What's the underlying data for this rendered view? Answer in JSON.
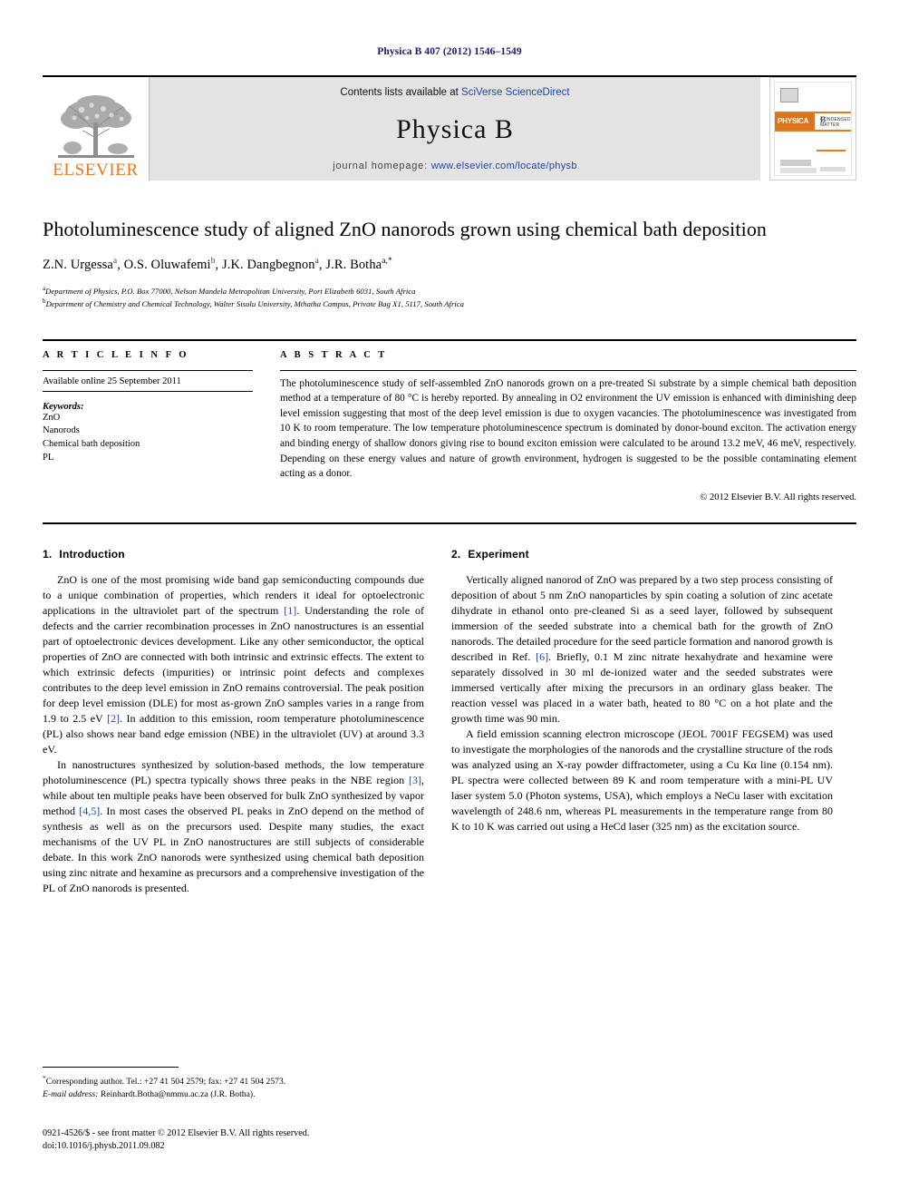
{
  "running_head": "Physica B 407 (2012) 1546–1549",
  "masthead": {
    "publisher_name": "ELSEVIER",
    "contents_prefix": "Contents lists available at ",
    "contents_link": "SciVerse ScienceDirect",
    "journal_name": "Physica B",
    "homepage_prefix": "journal homepage: ",
    "homepage_url": "www.elsevier.com/locate/physb",
    "cover": {
      "title": "PHYSICA",
      "volume_letter": "B",
      "subtitle": "CONDENSED MATTER"
    }
  },
  "article": {
    "title": "Photoluminescence study of aligned ZnO nanorods grown using chemical bath deposition",
    "authors_html": "Z.N. Urgessa a, O.S. Oluwafemi b, J.K. Dangbegnon a, J.R. Botha a,*",
    "authors": [
      {
        "name": "Z.N. Urgessa",
        "marks": "a"
      },
      {
        "name": "O.S. Oluwafemi",
        "marks": "b"
      },
      {
        "name": "J.K. Dangbegnon",
        "marks": "a"
      },
      {
        "name": "J.R. Botha",
        "marks": "a,*"
      }
    ],
    "affiliations": [
      {
        "mark": "a",
        "text": "Department of Physics, P.O. Box 77000, Nelson Mandela Metropolitan University, Port Elizabeth 6031, South Africa"
      },
      {
        "mark": "b",
        "text": "Department of Chemistry and Chemical Technology, Walter Sisulu University, Mthatha Campus, Private Bag X1, 5117, South Africa"
      }
    ]
  },
  "article_info": {
    "heading": "A R T I C L E  I N F O",
    "available_online": "Available online 25 September 2011",
    "keywords_label": "Keywords:",
    "keywords": [
      "ZnO",
      "Nanorods",
      "Chemical bath deposition",
      "PL"
    ]
  },
  "abstract": {
    "heading": "A B S T R A C T",
    "text": "The photoluminescence study of self-assembled ZnO nanorods grown on a pre-treated Si substrate by a simple chemical bath deposition method at a temperature of 80 °C is hereby reported. By annealing in O2 environment the UV emission is enhanced with diminishing deep level emission suggesting that most of the deep level emission is due to oxygen vacancies. The photoluminescence was investigated from 10 K to room temperature. The low temperature photoluminescence spectrum is dominated by donor-bound exciton. The activation energy and binding energy of shallow donors giving rise to bound exciton emission were calculated to be around 13.2 meV, 46 meV, respectively. Depending on these energy values and nature of growth environment, hydrogen is suggested to be the possible contaminating element acting as a donor.",
    "copyright": "© 2012 Elsevier B.V. All rights reserved."
  },
  "sections": {
    "introduction": {
      "heading_number": "1.",
      "heading_title": "Introduction",
      "paragraph1_a": "ZnO is one of the most promising wide band gap semiconducting compounds due to a unique combination of properties, which renders it ideal for optoelectronic applications in the ultraviolet part of the spectrum ",
      "paragraph1_ref1": "[1]",
      "paragraph1_b": ". Understanding the role of defects and the carrier recombination processes in ZnO nanostructures is an essential part of optoelectronic devices development. Like any other semiconductor, the optical properties of ZnO are connected with both intrinsic and extrinsic effects. The extent to which extrinsic defects (impurities) or intrinsic point defects and complexes contributes to the deep level emission in ZnO remains controversial. The peak position for deep level emission (DLE) for most as-grown ZnO samples varies in a range from 1.9 to 2.5 eV ",
      "paragraph1_ref2": "[2]",
      "paragraph1_c": ". In addition to this emission, room temperature photoluminescence (PL) also shows near band edge emission (NBE) in the ultraviolet (UV) at around 3.3 eV.",
      "paragraph2_a": "In nanostructures synthesized by solution-based methods, the low temperature photoluminescence (PL) spectra typically shows three peaks in the NBE region ",
      "paragraph2_ref3": "[3]",
      "paragraph2_b": ", while about ten multiple peaks have been observed for bulk ZnO synthesized by vapor method ",
      "paragraph2_ref45": "[4,5]",
      "paragraph2_c": ". In most cases the observed PL peaks in ZnO depend on the method of synthesis as well as on the precursors used. Despite many studies, the exact mechanisms of the UV PL in ZnO nanostructures are still subjects of considerable debate. In this work ZnO nanorods were synthesized using chemical bath deposition using zinc nitrate and hexamine as precursors and a comprehensive investigation of the PL of ZnO nanorods is presented."
    },
    "experiment": {
      "heading_number": "2.",
      "heading_title": "Experiment",
      "paragraph1_a": "Vertically aligned nanorod of ZnO was prepared by a two step process consisting of deposition of about 5 nm ZnO nanoparticles by spin coating a solution of zinc acetate dihydrate in ethanol onto pre-cleaned Si as a seed layer, followed by subsequent immersion of the seeded substrate into a chemical bath for the growth of ZnO nanorods. The detailed procedure for the seed particle formation and nanorod growth is described in Ref. ",
      "paragraph1_ref6": "[6]",
      "paragraph1_b": ". Briefly, 0.1 M zinc nitrate hexahydrate and hexamine were separately dissolved in 30 ml de-ionized water and the seeded substrates were immersed vertically after mixing the precursors in an ordinary glass beaker. The reaction vessel was placed in a water bath, heated to 80 °C on a hot plate and the growth time was 90 min.",
      "paragraph2": "A field emission scanning electron microscope (JEOL 7001F FEGSEM) was used to investigate the morphologies of the nanorods and the crystalline structure of the rods was analyzed using an X-ray powder diffractometer, using a Cu Kα line (0.154 nm). PL spectra were collected between 89 K and room temperature with a mini-PL UV laser system 5.0 (Photon systems, USA), which employs a NeCu laser with excitation wavelength of 248.6 nm, whereas PL measurements in the temperature range from 80 K to 10 K was carried out using a HeCd laser (325 nm) as the excitation source."
    }
  },
  "footnotes": {
    "corresponding": "Corresponding author. Tel.: +27 41 504 2579; fax: +27 41 504 2573.",
    "email_label": "E-mail address:",
    "email_value": "Reinhardt.Botha@nmmu.ac.za (J.R. Botha).",
    "issn_line": "0921-4526/$ - see front matter © 2012 Elsevier B.V. All rights reserved.",
    "doi_line": "doi:10.1016/j.physb.2011.09.082"
  },
  "colors": {
    "link": "#2244aa",
    "elsevier_orange": "#E87722",
    "running_head": "#1a1a6e"
  }
}
